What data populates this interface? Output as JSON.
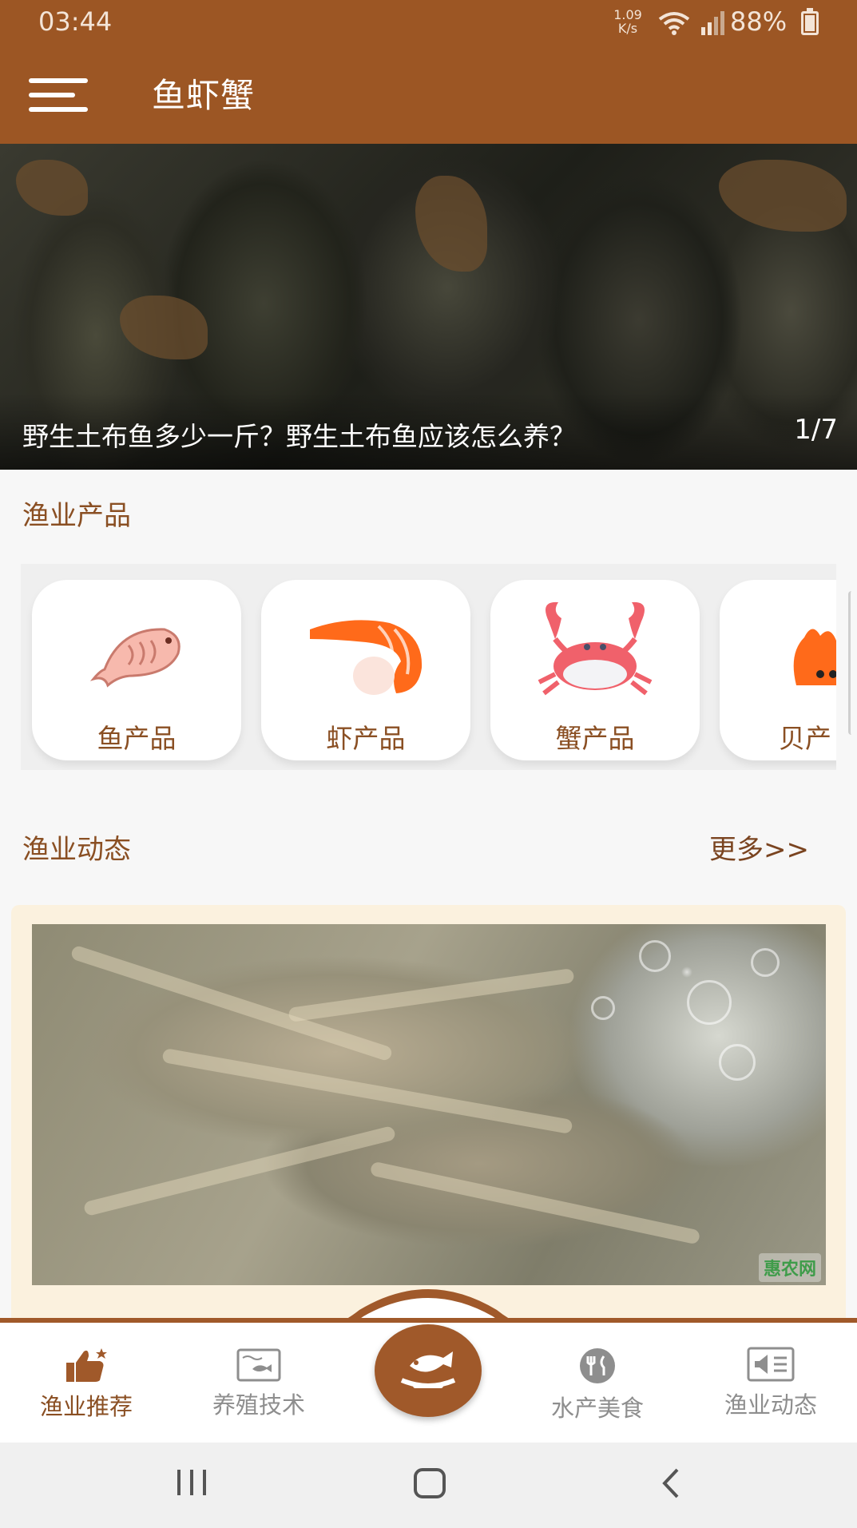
{
  "status_bar": {
    "time": "03:44",
    "net_speed_value": "1.09",
    "net_speed_unit": "K/s",
    "battery": "88%",
    "icons": [
      "wifi-icon",
      "signal-icon",
      "battery-charging-icon"
    ]
  },
  "app_bar": {
    "title": "鱼虾蟹",
    "menu_icon": "hamburger-menu-icon"
  },
  "banner": {
    "caption": "野生土布鱼多少一斤？野生土布鱼应该怎么养？",
    "index": "1/7"
  },
  "products": {
    "title": "渔业产品",
    "items": [
      {
        "label": "鱼产品",
        "icon": "fish-icon"
      },
      {
        "label": "虾产品",
        "icon": "shrimp-icon"
      },
      {
        "label": "蟹产品",
        "icon": "crab-icon"
      },
      {
        "label": "贝产",
        "icon": "shell-icon"
      }
    ]
  },
  "news": {
    "title": "渔业动态",
    "more": "更多>>",
    "watermark": "惠农网"
  },
  "bottom_nav": {
    "items": [
      {
        "label": "渔业推荐",
        "icon": "thumbs-up-icon",
        "active": true
      },
      {
        "label": "养殖技术",
        "icon": "aquarium-icon",
        "active": false
      },
      {
        "label": "",
        "icon": "fish-dish-icon",
        "active": false
      },
      {
        "label": "水产美食",
        "icon": "dining-icon",
        "active": false
      },
      {
        "label": "渔业动态",
        "icon": "speaker-news-icon",
        "active": false
      }
    ]
  },
  "colors": {
    "brand": "#9c5624",
    "accent_text": "#8a4f23",
    "inactive": "#8e8e8e"
  }
}
